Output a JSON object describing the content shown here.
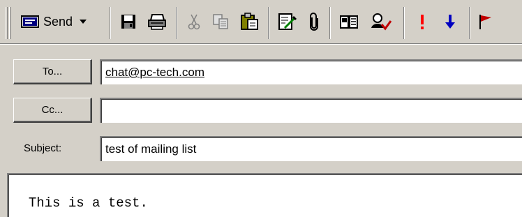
{
  "toolbar": {
    "send_label": "Send",
    "buttons": [
      "send-button",
      "save-icon",
      "print-icon",
      "cut-icon",
      "copy-icon",
      "paste-icon",
      "insert-file-icon",
      "attachment-icon",
      "address-book-icon",
      "check-names-icon",
      "high-importance-icon",
      "low-importance-icon",
      "flag-icon"
    ]
  },
  "header": {
    "to_label": "To...",
    "cc_label": "Cc...",
    "subject_label": "Subject:",
    "to_value": "chat@pc-tech.com",
    "cc_value": "",
    "subject_value": "test of mailing list"
  },
  "body": {
    "text": "This is a test."
  },
  "colors": {
    "chrome": "#d4d0c8",
    "importance_high": "#ff0000",
    "importance_low": "#0000c0"
  }
}
